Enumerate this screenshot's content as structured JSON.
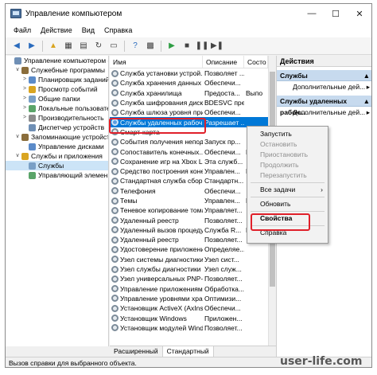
{
  "window": {
    "title": "Управление компьютером"
  },
  "menu": [
    "Файл",
    "Действие",
    "Вид",
    "Справка"
  ],
  "tree": [
    {
      "label": "Управление компьютером (л",
      "indent": 0,
      "icon": "computer-icon",
      "expander": ""
    },
    {
      "label": "Служебные программы",
      "indent": 1,
      "icon": "tools-icon",
      "expander": "∨"
    },
    {
      "label": "Планировщик заданий",
      "indent": 2,
      "icon": "clock-icon",
      "expander": ">"
    },
    {
      "label": "Просмотр событий",
      "indent": 2,
      "icon": "event-icon",
      "expander": ">"
    },
    {
      "label": "Общие папки",
      "indent": 2,
      "icon": "folder-icon",
      "expander": ">"
    },
    {
      "label": "Локальные пользовател",
      "indent": 2,
      "icon": "users-icon",
      "expander": ">"
    },
    {
      "label": "Производительность",
      "indent": 2,
      "icon": "perf-icon",
      "expander": ">"
    },
    {
      "label": "Диспетчер устройств",
      "indent": 2,
      "icon": "device-icon",
      "expander": ""
    },
    {
      "label": "Запоминающие устройств",
      "indent": 1,
      "icon": "storage-icon",
      "expander": "∨"
    },
    {
      "label": "Управление дисками",
      "indent": 2,
      "icon": "disk-icon",
      "expander": ""
    },
    {
      "label": "Службы и приложения",
      "indent": 1,
      "icon": "services-icon",
      "expander": "∨"
    },
    {
      "label": "Службы",
      "indent": 2,
      "icon": "gear-icon",
      "expander": "",
      "selected": true
    },
    {
      "label": "Управляющий элемен",
      "indent": 2,
      "icon": "wmi-icon",
      "expander": ""
    }
  ],
  "columns": {
    "name": "Имя",
    "desc": "Описание",
    "status": "Состо"
  },
  "services": [
    {
      "name": "Служба установки устрой...",
      "desc": "Позволяет ...",
      "status": ""
    },
    {
      "name": "Служба хранения данных ...",
      "desc": "Обеспечи...",
      "status": ""
    },
    {
      "name": "Служба хранилища",
      "desc": "Предоста...",
      "status": "Выпо"
    },
    {
      "name": "Служба шифрования диск...",
      "desc": "BDESVC пре...",
      "status": ""
    },
    {
      "name": "Служба шлюза уровня при...",
      "desc": "Обеспечи...",
      "status": ""
    },
    {
      "name": "Службы удаленных рабоч...",
      "desc": "Разрешает ...",
      "status": "",
      "selected": true
    },
    {
      "name": "Смарт-карта",
      "desc": "",
      "status": ""
    },
    {
      "name": "События получения неподв...",
      "desc": "Запуск пр...",
      "status": ""
    },
    {
      "name": "Сопоставитель конечных...",
      "desc": "Обеспечи...",
      "status": "Выпо"
    },
    {
      "name": "Сохранение игр на Xbox Live",
      "desc": "Эта служб...",
      "status": ""
    },
    {
      "name": "Средство построения конеч...",
      "desc": "Управлен...",
      "status": "Выпо"
    },
    {
      "name": "Стандартная служба сбор...",
      "desc": "Стандартн...",
      "status": ""
    },
    {
      "name": "Телефония",
      "desc": "Обеспечи...",
      "status": ""
    },
    {
      "name": "Темы",
      "desc": "Управлен...",
      "status": "Выпо"
    },
    {
      "name": "Теневое копирование тома",
      "desc": "Управляет...",
      "status": ""
    },
    {
      "name": "Удаленный реестр",
      "desc": "Позволяет...",
      "status": ""
    },
    {
      "name": "Удаленный вызов процедур",
      "desc": "Служба R...",
      "status": "Выпо"
    },
    {
      "name": "Удаленный реестр",
      "desc": "Позволяет...",
      "status": ""
    },
    {
      "name": "Удостоверение приложения",
      "desc": "Определяе...",
      "status": ""
    },
    {
      "name": "Узел системы диагностики",
      "desc": "Узел сист...",
      "status": ""
    },
    {
      "name": "Узел службы диагностики",
      "desc": "Узел служ...",
      "status": ""
    },
    {
      "name": "Узел универсальных PNP-...",
      "desc": "Позволяет...",
      "status": ""
    },
    {
      "name": "Управление приложениями",
      "desc": "Обработка...",
      "status": ""
    },
    {
      "name": "Управление уровнями хран...",
      "desc": "Оптимизи...",
      "status": ""
    },
    {
      "name": "Установщик ActiveX (AxIns...",
      "desc": "Обеспечи...",
      "status": ""
    },
    {
      "name": "Установщик Windows",
      "desc": "Приложен...",
      "status": ""
    },
    {
      "name": "Установщик модулей Wind...",
      "desc": "Позволяет...",
      "status": ""
    }
  ],
  "tabs": [
    "Расширенный",
    "Стандартный"
  ],
  "actions": {
    "title": "Действия",
    "sections": [
      {
        "label": "Службы",
        "item": "Дополнительные дей..."
      },
      {
        "label": "Службы удаленных рабоч...",
        "item": "Дополнительные дей..."
      }
    ]
  },
  "context_menu": [
    {
      "label": "Запустить",
      "disabled": false
    },
    {
      "label": "Остановить",
      "disabled": true
    },
    {
      "label": "Приостановить",
      "disabled": true
    },
    {
      "label": "Продолжить",
      "disabled": true
    },
    {
      "label": "Перезапустить",
      "disabled": true
    },
    {
      "sep": true
    },
    {
      "label": "Все задачи",
      "disabled": false,
      "submenu": true
    },
    {
      "sep": true
    },
    {
      "label": "Обновить",
      "disabled": false
    },
    {
      "sep": true
    },
    {
      "label": "Свойства",
      "disabled": false,
      "bold": true
    },
    {
      "sep": true
    },
    {
      "label": "Справка",
      "disabled": false
    }
  ],
  "status": "Вызов справки для выбранного объекта.",
  "watermark": "user-life.com",
  "colors": {
    "selection": "#0078d7",
    "highlight_box": "#e0202a",
    "action_section": "#c7daee"
  }
}
